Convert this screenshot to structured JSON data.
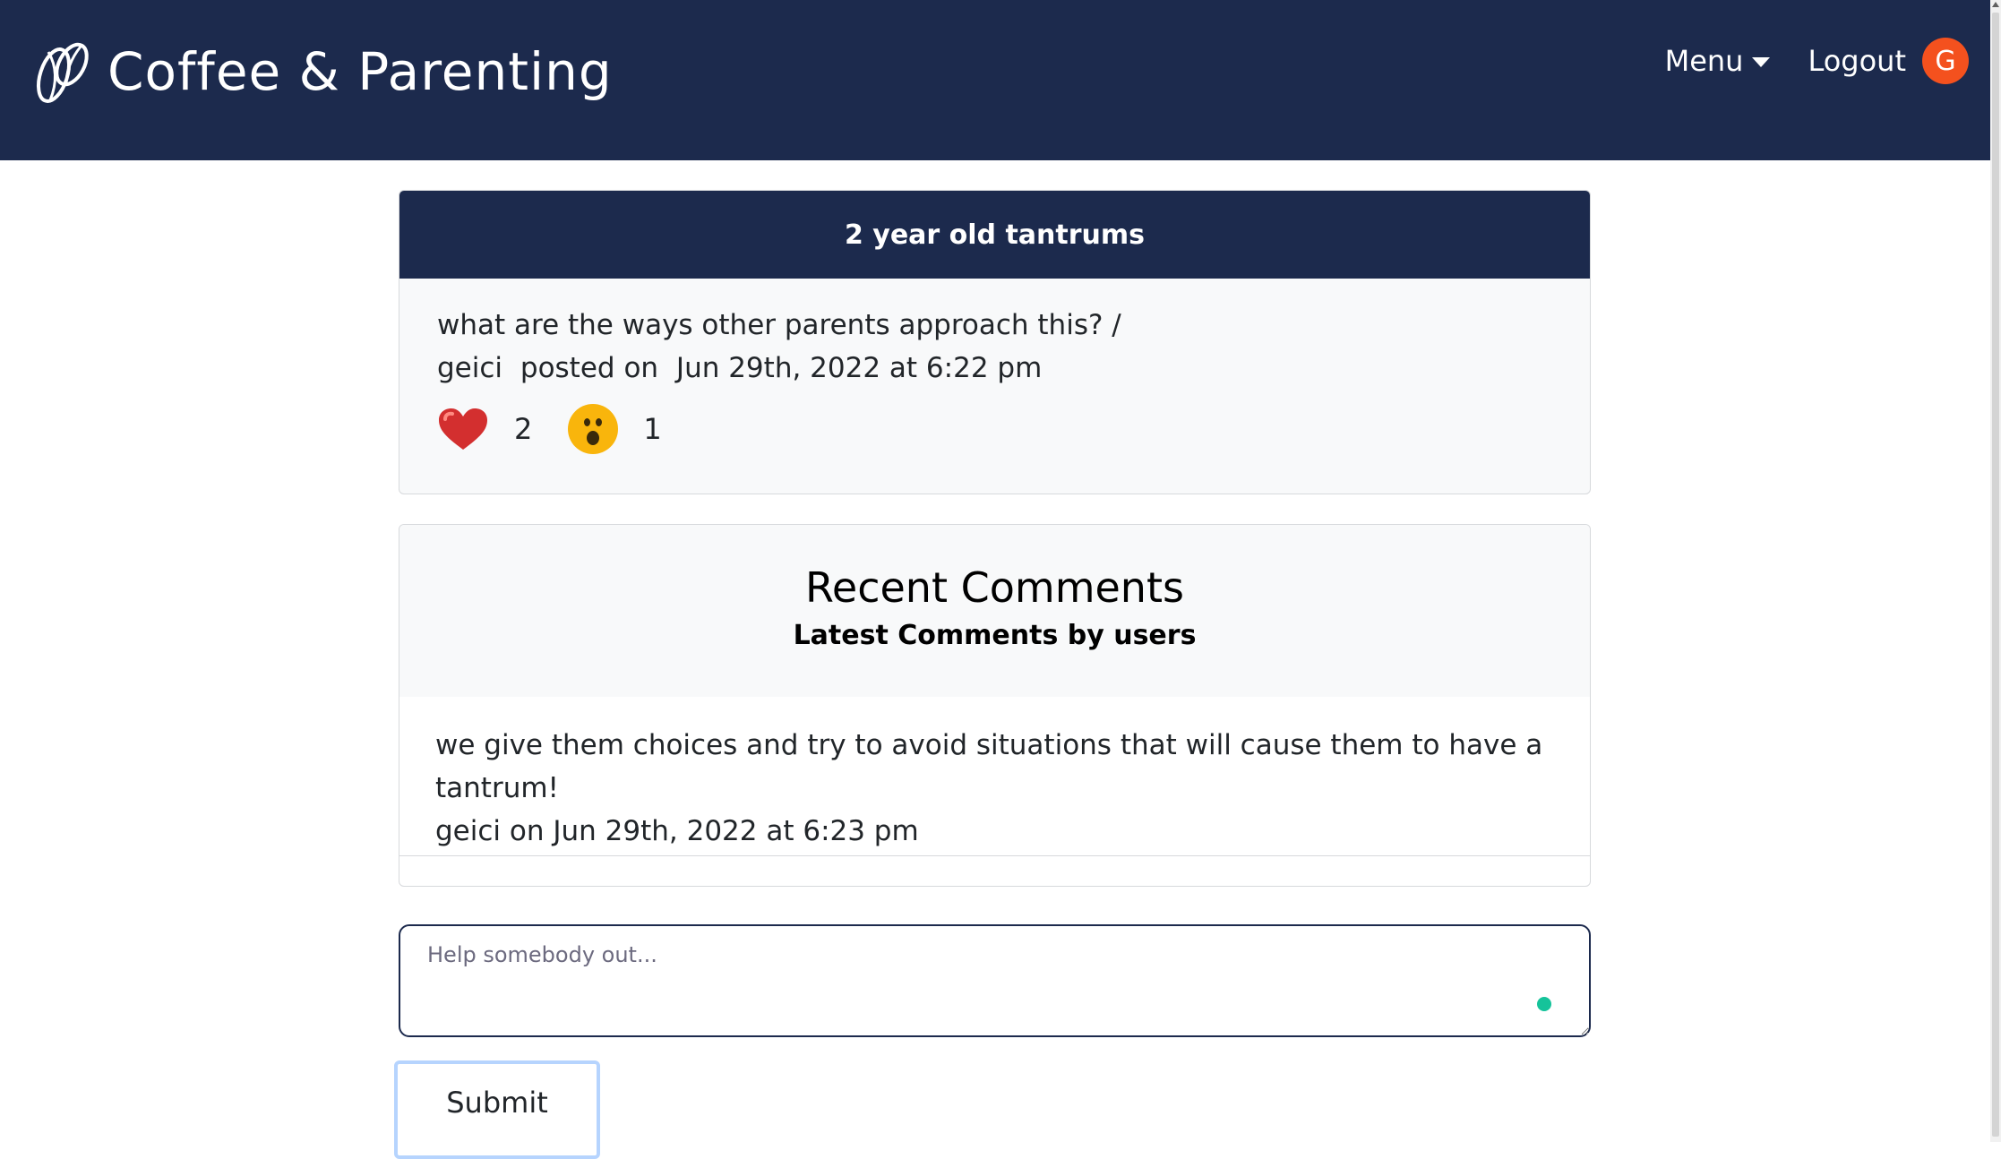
{
  "navbar": {
    "brand": "Coffee & Parenting",
    "menu_label": "Menu",
    "logout_label": "Logout",
    "avatar_initial": "G",
    "bg_color": "#1c2a4d",
    "avatar_color": "#f4511e"
  },
  "post": {
    "title": "2 year old tantrums",
    "body": "what are the ways other parents approach this? /",
    "author": "geici",
    "posted_label": "posted on",
    "date": "Jun 29th, 2022 at 6:22 pm",
    "reactions": [
      {
        "icon": "heart-icon",
        "count": "2"
      },
      {
        "icon": "astonished-face-icon",
        "count": "1"
      }
    ]
  },
  "comments": {
    "title": "Recent Comments",
    "subtitle": "Latest Comments by users",
    "items": [
      {
        "text": "we give them choices and try to avoid situations that will cause them to have a tantrum!",
        "meta": "geici on Jun 29th, 2022 at 6:23 pm"
      }
    ]
  },
  "form": {
    "placeholder": "Help somebody out...",
    "submit_label": "Submit"
  }
}
